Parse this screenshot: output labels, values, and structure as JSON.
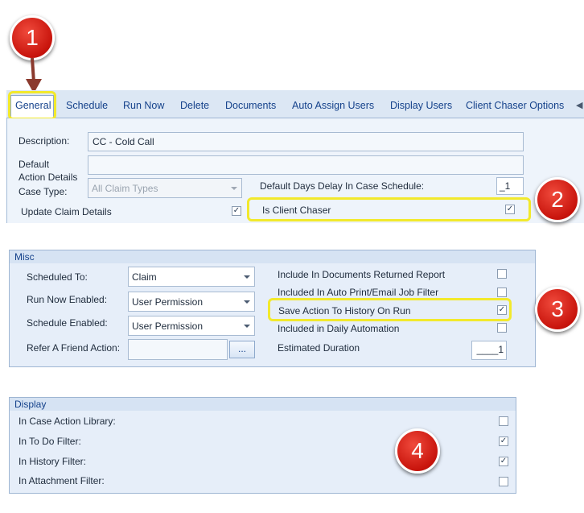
{
  "callouts": {
    "one": "1",
    "two": "2",
    "three": "3",
    "four": "4"
  },
  "tabs": [
    "General",
    "Schedule",
    "Run Now",
    "Delete",
    "Documents",
    "Auto Assign Users",
    "Display Users",
    "Client Chaser Options"
  ],
  "general": {
    "description_label": "Description:",
    "description_value": "CC - Cold Call",
    "default_action_details_label": "Default\nAction Details",
    "case_type_label": "Case Type:",
    "case_type_value": "All Claim Types",
    "default_days_label": "Default Days Delay In Case Schedule:",
    "default_days_value": "_1",
    "update_claim_label": "Update Claim Details",
    "update_claim_checked": true,
    "is_client_chaser_label": "Is Client Chaser",
    "is_client_chaser_checked": true
  },
  "misc": {
    "title": "Misc",
    "scheduled_to_label": "Scheduled To:",
    "scheduled_to_value": "Claim",
    "run_now_label": "Run Now Enabled:",
    "run_now_value": "User Permission",
    "schedule_enabled_label": "Schedule Enabled:",
    "schedule_enabled_value": "User Permission",
    "refer_label": "Refer A Friend Action:",
    "refer_button": "...",
    "include_docs_label": "Include In Documents Returned Report",
    "include_docs_checked": false,
    "auto_print_label": "Included In Auto Print/Email Job Filter",
    "auto_print_checked": false,
    "save_history_label": "Save Action To History On Run",
    "save_history_checked": true,
    "daily_auto_label": "Included in Daily Automation",
    "daily_auto_checked": false,
    "est_duration_label": "Estimated Duration",
    "est_duration_value": "____1"
  },
  "display": {
    "title": "Display",
    "items": [
      {
        "label": "In Case Action Library:",
        "checked": false
      },
      {
        "label": "In To Do Filter:",
        "checked": true
      },
      {
        "label": "In History Filter:",
        "checked": true
      },
      {
        "label": "In Attachment Filter:",
        "checked": false
      }
    ]
  },
  "colors": {
    "highlight": "#f2e92c",
    "badge": "#d21a10",
    "tab_text": "#15428b"
  }
}
